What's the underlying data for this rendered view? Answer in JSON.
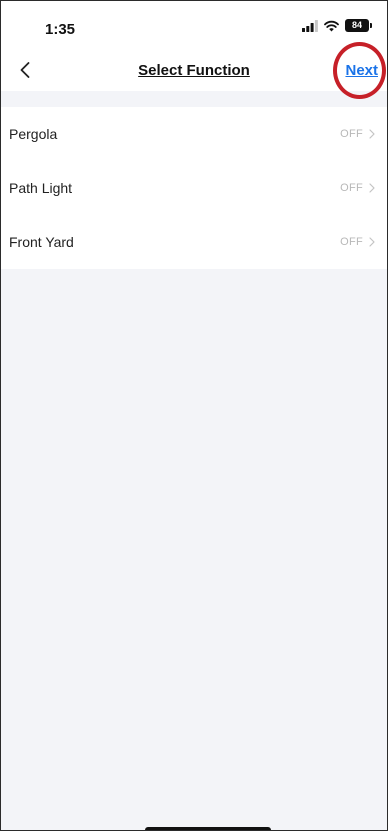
{
  "status_bar": {
    "time": "1:35",
    "battery": "84"
  },
  "nav": {
    "title": "Select Function",
    "next_label": "Next"
  },
  "functions": [
    {
      "label": "Pergola",
      "status": "OFF"
    },
    {
      "label": "Path Light",
      "status": "OFF"
    },
    {
      "label": "Front Yard",
      "status": "OFF"
    }
  ],
  "colors": {
    "accent": "#1a73e8",
    "highlight": "#c62028",
    "background": "#f3f4f8"
  },
  "icons": {
    "back": "chevron-left-icon",
    "row_arrow": "chevron-right-icon",
    "signal": "cellular-signal-icon",
    "wifi": "wifi-icon",
    "battery": "battery-icon"
  }
}
